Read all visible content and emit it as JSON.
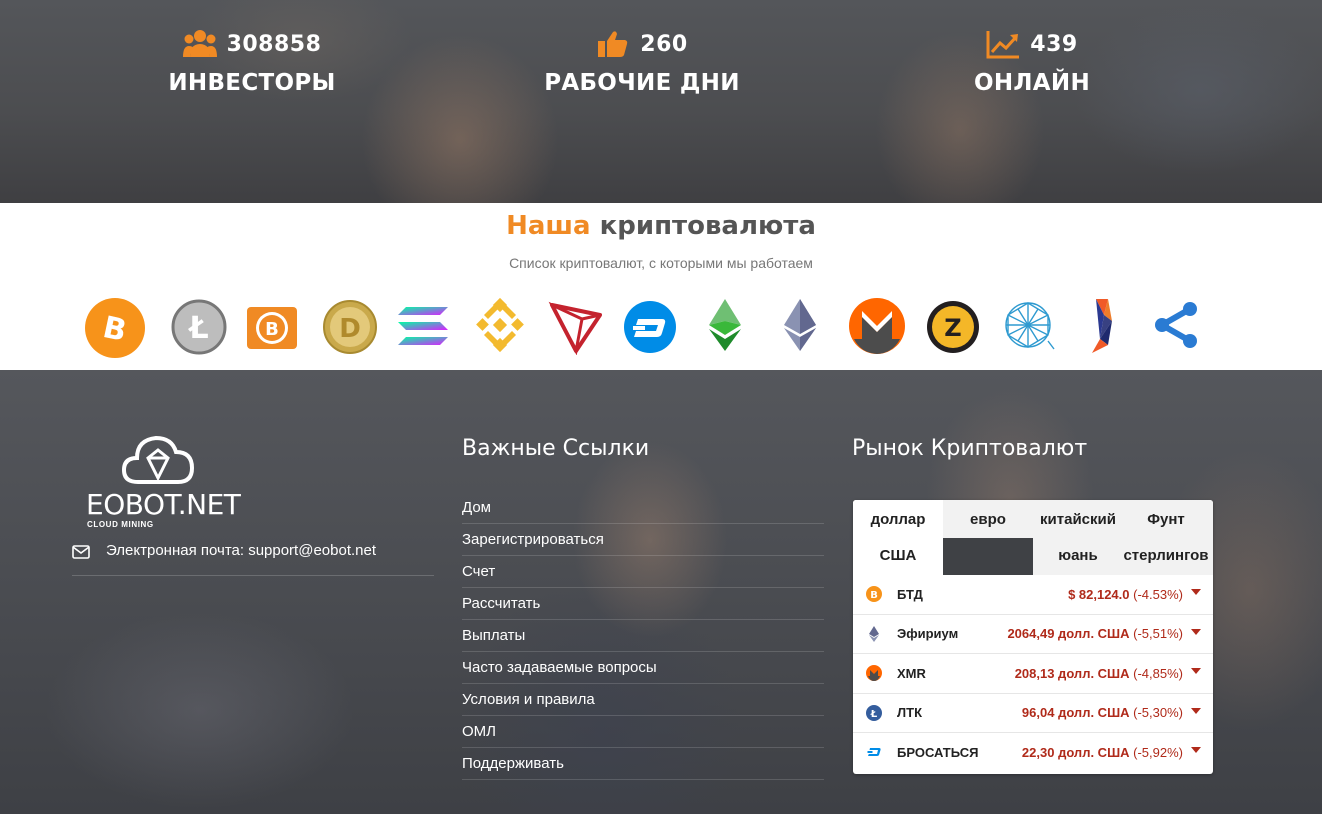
{
  "stats": [
    {
      "icon": "users-icon",
      "value": "308858",
      "label": "ИНВЕСТОРЫ"
    },
    {
      "icon": "thumbs-up-icon",
      "value": "260",
      "label": "РАБОЧИЕ ДНИ"
    },
    {
      "icon": "trend-chart-icon",
      "value": "439",
      "label": "ОНЛАЙН"
    }
  ],
  "crypto_section": {
    "title_accent": "Наша",
    "title_rest": "криптовалюта",
    "subtitle": "Список криптовалют, с которыми мы работаем",
    "coins": [
      "bitcoin",
      "litecoin",
      "bitcoin-cash",
      "dogecoin",
      "solana",
      "binance",
      "tron",
      "dash",
      "ethereum-classic",
      "ethereum",
      "monero",
      "zcash",
      "qtum",
      "ravencoin",
      "ripple"
    ]
  },
  "footer": {
    "logo_name": "EOBOT.NET",
    "logo_sub": "CLOUD MINING",
    "email_label": "Электронная почта: support@eobot.net",
    "links_title": "Важные Ссылки",
    "links": [
      "Дом",
      "Зарегистрироваться",
      "Счет",
      "Рассчитать",
      "Выплаты",
      "Часто задаваемые вопросы",
      "Условия и правила",
      "ОМЛ",
      "Поддерживать"
    ],
    "market_title": "Рынок Криптовалют"
  },
  "market": {
    "tabs": [
      "доллар США",
      "евро",
      "китайский юань",
      "Фунт стерлингов"
    ],
    "active_tab": "доллар США",
    "rows": [
      {
        "icon": "bitcoin-icon",
        "name": "БТД",
        "price": "$ 82,124.0",
        "change": "(-4.53%)"
      },
      {
        "icon": "ethereum-icon",
        "name": "Эфириум",
        "price": "2064,49 долл. США",
        "change": "(-5,51%)"
      },
      {
        "icon": "monero-icon",
        "name": "XMR",
        "price": "208,13 долл. США",
        "change": "(-4,85%)"
      },
      {
        "icon": "litecoin-icon",
        "name": "ЛТК",
        "price": "96,04 долл. США",
        "change": "(-5,30%)"
      },
      {
        "icon": "dash-icon",
        "name": "БРОСАТЬСЯ",
        "price": "22,30 долл. США",
        "change": "(-5,92%)"
      }
    ]
  },
  "colors": {
    "accent": "#f08a24",
    "price_down": "#b02a1a"
  }
}
